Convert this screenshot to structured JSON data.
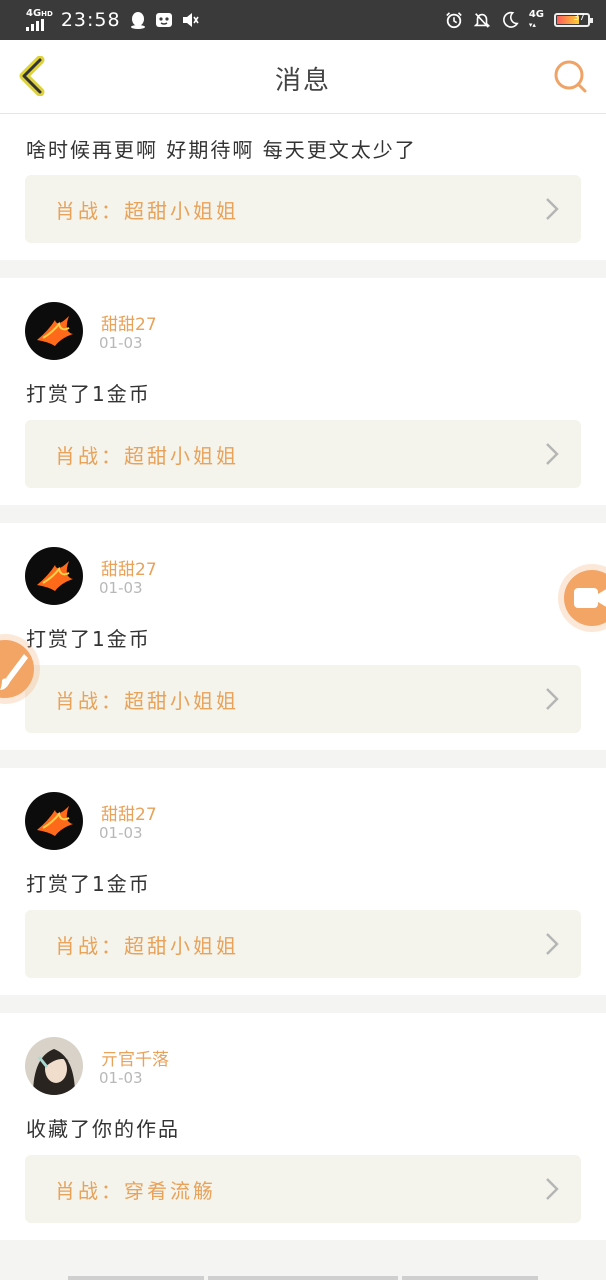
{
  "status_bar": {
    "network": "4G",
    "hd": "HD",
    "time": "23:58",
    "network_right": "4G",
    "battery_level": "37",
    "icons": [
      "qq-icon",
      "notification-app-icon",
      "mute-icon",
      "alarm-icon",
      "dnd-bell-icon",
      "moon-icon",
      "battery-icon"
    ]
  },
  "header": {
    "title": "消息",
    "back_icon": "chevron-left-icon",
    "search_icon": "search-icon"
  },
  "messages": [
    {
      "comment": "啥时候再更啊  好期待啊  每天更文太少了",
      "work": "肖战：超甜小姐姐"
    },
    {
      "user": "甜甜27",
      "date": "01-03",
      "text": "打赏了1金币",
      "work": "肖战：超甜小姐姐"
    },
    {
      "user": "甜甜27",
      "date": "01-03",
      "text": "打赏了1金币",
      "work": "肖战：超甜小姐姐"
    },
    {
      "user": "甜甜27",
      "date": "01-03",
      "text": "打赏了1金币",
      "work": "肖战：超甜小姐姐"
    },
    {
      "user": "亓官千落",
      "date": "01-03",
      "text": "收藏了你的作品",
      "work": "肖战：穿肴流觞"
    }
  ],
  "colors": {
    "accent": "#e8a25a",
    "fab": "#f3a565",
    "card_bg": "#ffffff",
    "work_bg": "#f4f4ec",
    "page_bg": "#f4f4f2",
    "status_bar": "#3a3a3a"
  },
  "floating": {
    "video_icon": "video-camera-icon",
    "edit_icon": "brush-icon"
  }
}
